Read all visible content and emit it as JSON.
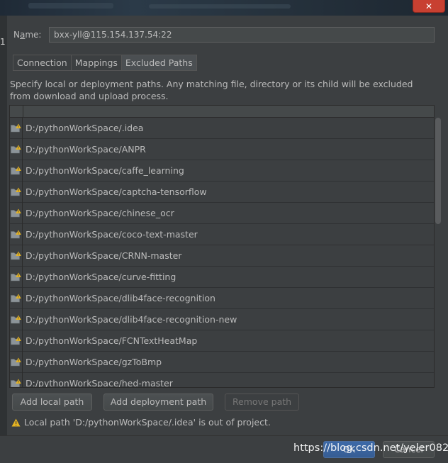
{
  "window": {
    "close_glyph": "✕",
    "left_edge_text": "1"
  },
  "name_field": {
    "label_prefix": "N",
    "label_underlined": "a",
    "label_suffix": "me:",
    "value": "bxx-yll@115.154.137.54:22"
  },
  "tabs": [
    {
      "label": "Connection",
      "active": false
    },
    {
      "label": "Mappings",
      "active": false
    },
    {
      "label": "Excluded Paths",
      "active": true
    }
  ],
  "description": "Specify local or deployment paths. Any matching file, directory or its child will be excluded from download and upload process.",
  "excluded_paths": [
    "D:/pythonWorkSpace/.idea",
    "D:/pythonWorkSpace/ANPR",
    "D:/pythonWorkSpace/caffe_learning",
    "D:/pythonWorkSpace/captcha-tensorflow",
    "D:/pythonWorkSpace/chinese_ocr",
    "D:/pythonWorkSpace/coco-text-master",
    "D:/pythonWorkSpace/CRNN-master",
    "D:/pythonWorkSpace/curve-fitting",
    "D:/pythonWorkSpace/dlib4face-recognition",
    "D:/pythonWorkSpace/dlib4face-recognition-new",
    "D:/pythonWorkSpace/FCNTextHeatMap",
    "D:/pythonWorkSpace/gzToBmp",
    "D:/pythonWorkSpace/hed-master"
  ],
  "buttons": {
    "add_local_path": "Add local path",
    "add_deployment_path": "Add deployment path",
    "remove_path": "Remove path",
    "ok": "OK",
    "cancel": "Cancel"
  },
  "warning": "Local path 'D:/pythonWorkSpace/.idea' is out of project.",
  "watermark": "https://blog.csdn.net/yeler082",
  "colors": {
    "background": "#3c3f41",
    "text": "#bbbbbb",
    "folder": "#8c9499",
    "warning": "#e6b422",
    "ok_button": "#365d94",
    "close_button": "#c84031"
  },
  "icons": {
    "folder": "folder-warning-icon",
    "warning": "warning-icon",
    "close": "close-icon"
  }
}
